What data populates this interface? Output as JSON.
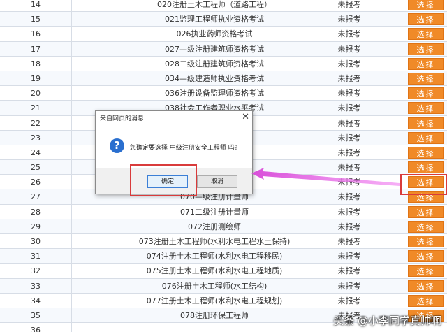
{
  "table": {
    "button_label": "选择",
    "rows": [
      {
        "num": "14",
        "name": "020注册土木工程师（道路工程）",
        "status": "未报考"
      },
      {
        "num": "15",
        "name": "021监理工程师执业资格考试",
        "status": "未报考"
      },
      {
        "num": "16",
        "name": "026执业药师资格考试",
        "status": "未报考"
      },
      {
        "num": "17",
        "name": "027—级注册建筑师资格考试",
        "status": "未报考"
      },
      {
        "num": "18",
        "name": "028二级注册建筑师资格考试",
        "status": "未报考"
      },
      {
        "num": "19",
        "name": "034—级建造师执业资格考试",
        "status": "未报考"
      },
      {
        "num": "20",
        "name": "036注册设备监理师资格考试",
        "status": "未报考"
      },
      {
        "num": "21",
        "name": "038社会工作者职业水平考试",
        "status": "未报考"
      },
      {
        "num": "22",
        "name": "",
        "status": "未报考"
      },
      {
        "num": "23",
        "name": "",
        "status": "未报考"
      },
      {
        "num": "24",
        "name": "",
        "status": "未报考"
      },
      {
        "num": "25",
        "name": "",
        "status": "未报考"
      },
      {
        "num": "26",
        "name": "",
        "status": "未报考"
      },
      {
        "num": "27",
        "name": "070—级注册计量师",
        "status": "未报考"
      },
      {
        "num": "28",
        "name": "071二级注册计量师",
        "status": "未报考"
      },
      {
        "num": "29",
        "name": "072注册测绘师",
        "status": "未报考"
      },
      {
        "num": "30",
        "name": "073注册土木工程师(水利水电工程水土保持)",
        "status": "未报考"
      },
      {
        "num": "31",
        "name": "074注册土木工程师(水利水电工程移民)",
        "status": "未报考"
      },
      {
        "num": "32",
        "name": "075注册土木工程师(水利水电工程地质)",
        "status": "未报考"
      },
      {
        "num": "33",
        "name": "076注册土木工程师(水工结构)",
        "status": "未报考"
      },
      {
        "num": "34",
        "name": "077注册土木工程师(水利水电工程规划)",
        "status": "未报考"
      },
      {
        "num": "35",
        "name": "078注册环保工程师",
        "status": "未报考"
      },
      {
        "num": "36",
        "name": "",
        "status": ""
      }
    ]
  },
  "dialog": {
    "title": "来自网页的消息",
    "close_glyph": "✕",
    "icon_glyph": "?",
    "message": "您确定要选择 中级注册安全工程师 吗?",
    "ok_label": "确定",
    "cancel_label": "取消"
  },
  "annotation": {
    "color": "#d93b3b",
    "arrow_color": "#e040e0"
  },
  "watermark": "头条 @小李同学真帅啊"
}
